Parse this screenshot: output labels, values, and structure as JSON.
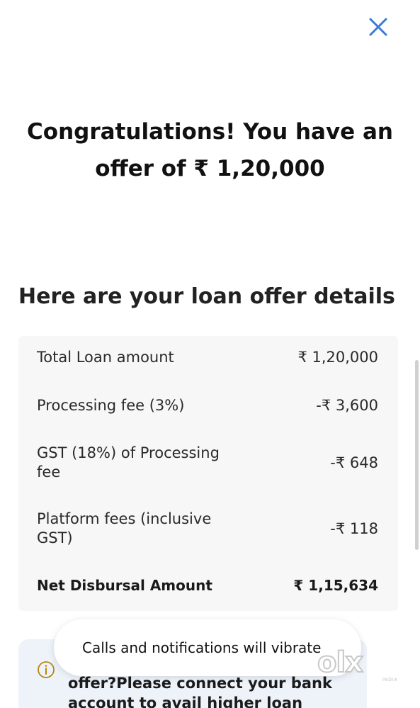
{
  "colors": {
    "accent": "#3a7bd5",
    "card_bg": "#f7f7f7",
    "info_bg": "#eef3fa",
    "info_icon": "#b8860b"
  },
  "header": {
    "close_icon": "close-icon"
  },
  "offer": {
    "headline": "Congratulations! You have an offer of ₹ 1,20,000"
  },
  "details": {
    "title": "Here are your loan offer details",
    "rows": [
      {
        "label": "Total Loan amount",
        "value": "₹ 1,20,000"
      },
      {
        "label": "Processing fee (3%)",
        "value": "-₹ 3,600"
      },
      {
        "label": "GST (18%) of Processing fee",
        "value": "-₹ 648"
      },
      {
        "label": "Platform fees (inclusive GST)",
        "value": "-₹ 118"
      }
    ],
    "total": {
      "label": "Net Disbursal Amount",
      "value": "₹ 1,15,634"
    }
  },
  "info": {
    "icon": "info-icon",
    "text": "offer?Please connect your bank account to avail higher loan"
  },
  "toast": {
    "text": "Calls and notifications will vibrate"
  },
  "watermark": {
    "text": "olx",
    "sub": "INDIA"
  }
}
